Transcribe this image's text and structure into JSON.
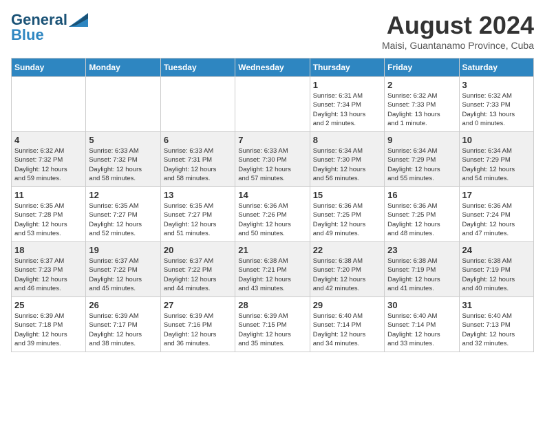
{
  "header": {
    "logo_line1": "General",
    "logo_line2": "Blue",
    "month_title": "August 2024",
    "location": "Maisi, Guantanamo Province, Cuba"
  },
  "weekdays": [
    "Sunday",
    "Monday",
    "Tuesday",
    "Wednesday",
    "Thursday",
    "Friday",
    "Saturday"
  ],
  "weeks": [
    [
      {
        "day": "",
        "info": ""
      },
      {
        "day": "",
        "info": ""
      },
      {
        "day": "",
        "info": ""
      },
      {
        "day": "",
        "info": ""
      },
      {
        "day": "1",
        "info": "Sunrise: 6:31 AM\nSunset: 7:34 PM\nDaylight: 13 hours\nand 2 minutes."
      },
      {
        "day": "2",
        "info": "Sunrise: 6:32 AM\nSunset: 7:33 PM\nDaylight: 13 hours\nand 1 minute."
      },
      {
        "day": "3",
        "info": "Sunrise: 6:32 AM\nSunset: 7:33 PM\nDaylight: 13 hours\nand 0 minutes."
      }
    ],
    [
      {
        "day": "4",
        "info": "Sunrise: 6:32 AM\nSunset: 7:32 PM\nDaylight: 12 hours\nand 59 minutes."
      },
      {
        "day": "5",
        "info": "Sunrise: 6:33 AM\nSunset: 7:32 PM\nDaylight: 12 hours\nand 58 minutes."
      },
      {
        "day": "6",
        "info": "Sunrise: 6:33 AM\nSunset: 7:31 PM\nDaylight: 12 hours\nand 58 minutes."
      },
      {
        "day": "7",
        "info": "Sunrise: 6:33 AM\nSunset: 7:30 PM\nDaylight: 12 hours\nand 57 minutes."
      },
      {
        "day": "8",
        "info": "Sunrise: 6:34 AM\nSunset: 7:30 PM\nDaylight: 12 hours\nand 56 minutes."
      },
      {
        "day": "9",
        "info": "Sunrise: 6:34 AM\nSunset: 7:29 PM\nDaylight: 12 hours\nand 55 minutes."
      },
      {
        "day": "10",
        "info": "Sunrise: 6:34 AM\nSunset: 7:29 PM\nDaylight: 12 hours\nand 54 minutes."
      }
    ],
    [
      {
        "day": "11",
        "info": "Sunrise: 6:35 AM\nSunset: 7:28 PM\nDaylight: 12 hours\nand 53 minutes."
      },
      {
        "day": "12",
        "info": "Sunrise: 6:35 AM\nSunset: 7:27 PM\nDaylight: 12 hours\nand 52 minutes."
      },
      {
        "day": "13",
        "info": "Sunrise: 6:35 AM\nSunset: 7:27 PM\nDaylight: 12 hours\nand 51 minutes."
      },
      {
        "day": "14",
        "info": "Sunrise: 6:36 AM\nSunset: 7:26 PM\nDaylight: 12 hours\nand 50 minutes."
      },
      {
        "day": "15",
        "info": "Sunrise: 6:36 AM\nSunset: 7:25 PM\nDaylight: 12 hours\nand 49 minutes."
      },
      {
        "day": "16",
        "info": "Sunrise: 6:36 AM\nSunset: 7:25 PM\nDaylight: 12 hours\nand 48 minutes."
      },
      {
        "day": "17",
        "info": "Sunrise: 6:36 AM\nSunset: 7:24 PM\nDaylight: 12 hours\nand 47 minutes."
      }
    ],
    [
      {
        "day": "18",
        "info": "Sunrise: 6:37 AM\nSunset: 7:23 PM\nDaylight: 12 hours\nand 46 minutes."
      },
      {
        "day": "19",
        "info": "Sunrise: 6:37 AM\nSunset: 7:22 PM\nDaylight: 12 hours\nand 45 minutes."
      },
      {
        "day": "20",
        "info": "Sunrise: 6:37 AM\nSunset: 7:22 PM\nDaylight: 12 hours\nand 44 minutes."
      },
      {
        "day": "21",
        "info": "Sunrise: 6:38 AM\nSunset: 7:21 PM\nDaylight: 12 hours\nand 43 minutes."
      },
      {
        "day": "22",
        "info": "Sunrise: 6:38 AM\nSunset: 7:20 PM\nDaylight: 12 hours\nand 42 minutes."
      },
      {
        "day": "23",
        "info": "Sunrise: 6:38 AM\nSunset: 7:19 PM\nDaylight: 12 hours\nand 41 minutes."
      },
      {
        "day": "24",
        "info": "Sunrise: 6:38 AM\nSunset: 7:19 PM\nDaylight: 12 hours\nand 40 minutes."
      }
    ],
    [
      {
        "day": "25",
        "info": "Sunrise: 6:39 AM\nSunset: 7:18 PM\nDaylight: 12 hours\nand 39 minutes."
      },
      {
        "day": "26",
        "info": "Sunrise: 6:39 AM\nSunset: 7:17 PM\nDaylight: 12 hours\nand 38 minutes."
      },
      {
        "day": "27",
        "info": "Sunrise: 6:39 AM\nSunset: 7:16 PM\nDaylight: 12 hours\nand 36 minutes."
      },
      {
        "day": "28",
        "info": "Sunrise: 6:39 AM\nSunset: 7:15 PM\nDaylight: 12 hours\nand 35 minutes."
      },
      {
        "day": "29",
        "info": "Sunrise: 6:40 AM\nSunset: 7:14 PM\nDaylight: 12 hours\nand 34 minutes."
      },
      {
        "day": "30",
        "info": "Sunrise: 6:40 AM\nSunset: 7:14 PM\nDaylight: 12 hours\nand 33 minutes."
      },
      {
        "day": "31",
        "info": "Sunrise: 6:40 AM\nSunset: 7:13 PM\nDaylight: 12 hours\nand 32 minutes."
      }
    ]
  ]
}
